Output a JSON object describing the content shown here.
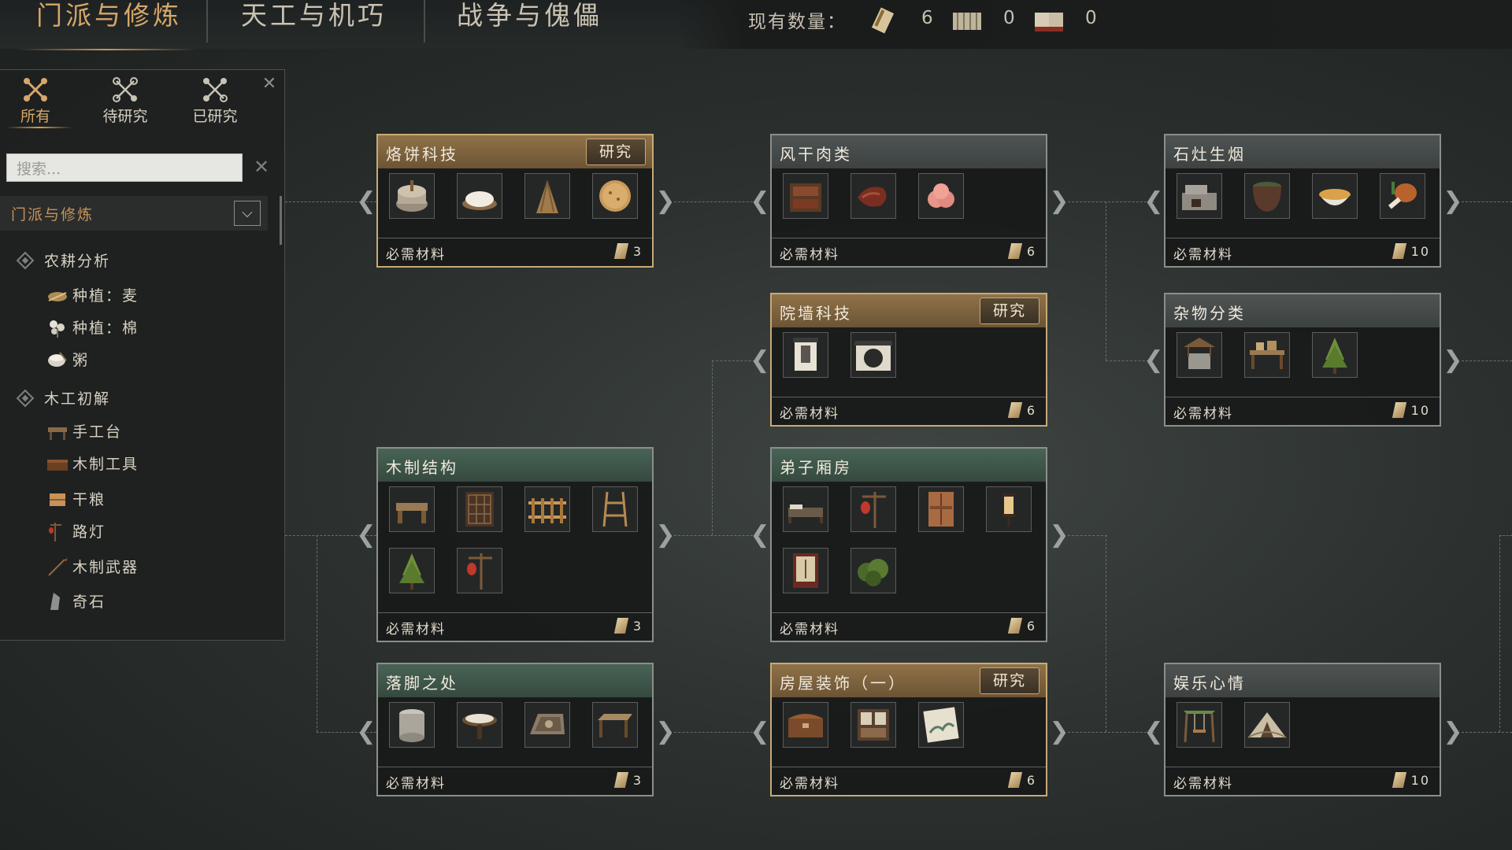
{
  "top_tabs": [
    "门派与修炼",
    "天工与机巧",
    "战争与傀儡"
  ],
  "resources": {
    "label": "现有数量：",
    "items": [
      {
        "icon": "scroll-note-icon",
        "value": "6"
      },
      {
        "icon": "bamboo-scroll-icon",
        "value": "0"
      },
      {
        "icon": "book-icon",
        "value": "0"
      }
    ]
  },
  "sidebar": {
    "tabs": [
      "所有",
      "待研究",
      "已研究"
    ],
    "search_placeholder": "搜索...",
    "category": "门派与修炼",
    "groups": [
      {
        "label": "农耕分析",
        "items": [
          "种植：麦",
          "种植：棉",
          "粥"
        ]
      },
      {
        "label": "木工初解",
        "items": [
          "手工台",
          "木制工具",
          "干粮",
          "路灯",
          "木制武器",
          "奇石"
        ]
      }
    ]
  },
  "cards": [
    {
      "title": "烙饼科技",
      "research": "研究",
      "footer": "必需材料",
      "cost": "3",
      "icons": [
        "millstone-icon",
        "flour-icon",
        "wheat-bundle-icon",
        "flatbread-icon"
      ]
    },
    {
      "title": "风干肉类",
      "research": "",
      "footer": "必需材料",
      "cost": "6",
      "icons": [
        "drying-rack-icon",
        "dried-meat-icon",
        "peach-icon"
      ]
    },
    {
      "title": "石灶生烟",
      "research": "",
      "footer": "必需材料",
      "cost": "10",
      "icons": [
        "stone-stove-icon",
        "clay-pot-icon",
        "soup-bowl-icon",
        "meat-leg-icon"
      ]
    },
    {
      "title": "院墙科技",
      "research": "研究",
      "footer": "必需材料",
      "cost": "6",
      "icons": [
        "wall-icon",
        "moon-gate-icon"
      ]
    },
    {
      "title": "杂物分类",
      "research": "",
      "footer": "必需材料",
      "cost": "10",
      "icons": [
        "well-icon",
        "storage-shelf-icon",
        "tree-icon"
      ]
    },
    {
      "title": "木制结构",
      "research": "",
      "footer": "必需材料",
      "cost": "3",
      "icons": [
        "wood-bench-icon",
        "lattice-door-icon",
        "fence-icon",
        "shelf-rack-icon",
        "tree-icon",
        "lantern-post-icon"
      ]
    },
    {
      "title": "弟子厢房",
      "research": "",
      "footer": "必需材料",
      "cost": "6",
      "icons": [
        "bed-icon",
        "lantern-post-icon",
        "wardrobe-icon",
        "lamp-icon",
        "screen-icon",
        "bush-icon"
      ]
    },
    {
      "title": "落脚之处",
      "research": "",
      "footer": "必需材料",
      "cost": "3",
      "icons": [
        "stone-drum-icon",
        "round-table-icon",
        "carpet-icon",
        "table-icon"
      ]
    },
    {
      "title": "房屋装饰（一）",
      "research": "研究",
      "footer": "必需材料",
      "cost": "6",
      "icons": [
        "chest-icon",
        "cabinet-icon",
        "painting-icon"
      ]
    },
    {
      "title": "娱乐心情",
      "research": "",
      "footer": "必需材料",
      "cost": "10",
      "icons": [
        "swing-icon",
        "tent-icon"
      ]
    }
  ],
  "colors": {
    "gold": "#c9a978",
    "green": "#486456",
    "gray": "#4e5453",
    "accent": "#d6a76a"
  }
}
